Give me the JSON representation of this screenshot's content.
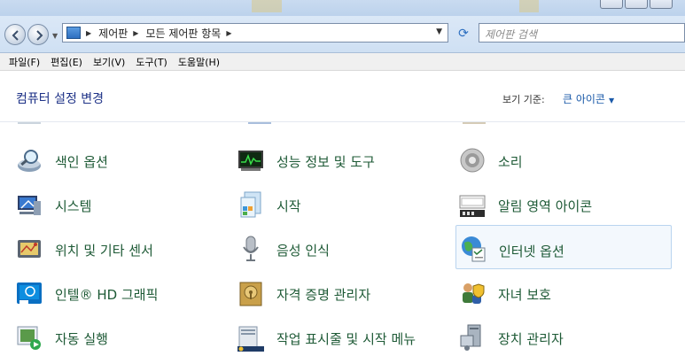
{
  "breadcrumb": [
    "제어판",
    "모든 제어판 항목"
  ],
  "search": {
    "placeholder": "제어판 검색"
  },
  "menu": [
    "파일(F)",
    "편집(E)",
    "보기(V)",
    "도구(T)",
    "도움말(H)"
  ],
  "header": {
    "title": "컴퓨터 설정 변경",
    "view_by_label": "보기 기준:",
    "view_by_value": "큰 아이콘"
  },
  "items": [
    {
      "label": "색인 옵션",
      "icon": "indexing-magnifier-icon"
    },
    {
      "label": "성능 정보 및 도구",
      "icon": "performance-monitor-icon"
    },
    {
      "label": "소리",
      "icon": "speaker-icon"
    },
    {
      "label": "시스템",
      "icon": "computer-system-icon"
    },
    {
      "label": "시작",
      "icon": "getting-started-icon"
    },
    {
      "label": "알림 영역 아이콘",
      "icon": "notification-tray-icon"
    },
    {
      "label": "위치 및 기타 센서",
      "icon": "location-sensor-icon"
    },
    {
      "label": "음성 인식",
      "icon": "microphone-icon"
    },
    {
      "label": "인터넷 옵션",
      "icon": "internet-globe-icon"
    },
    {
      "label": "인텔® HD 그래픽",
      "icon": "intel-graphics-icon"
    },
    {
      "label": "자격 증명 관리자",
      "icon": "credential-vault-icon"
    },
    {
      "label": "자녀 보호",
      "icon": "parental-controls-icon"
    },
    {
      "label": "자동 실행",
      "icon": "autoplay-icon"
    },
    {
      "label": "작업 표시줄 및 시작 메뉴",
      "icon": "taskbar-icon"
    },
    {
      "label": "장치 관리자",
      "icon": "device-manager-icon"
    }
  ],
  "hovered_item": "인터넷 옵션"
}
